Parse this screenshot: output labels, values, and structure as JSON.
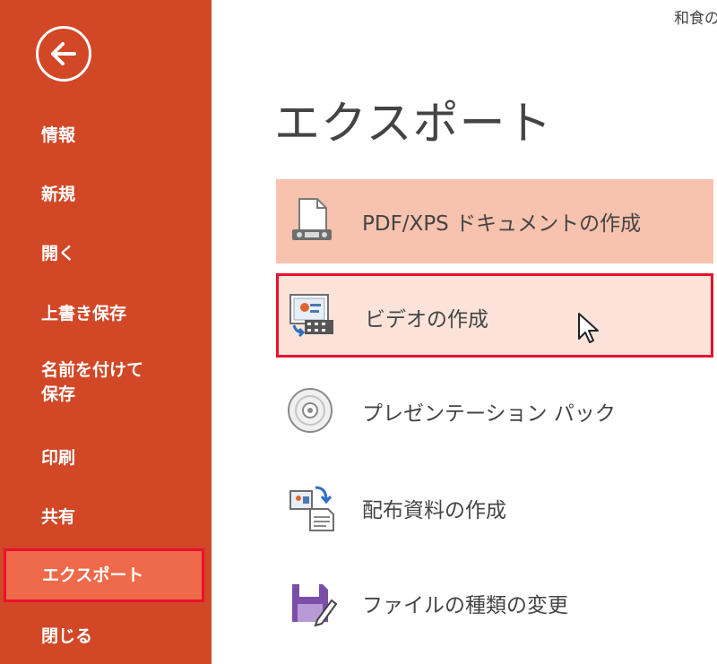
{
  "window": {
    "doc_title": "和食の"
  },
  "sidebar": {
    "back_icon": "back-arrow-icon",
    "items": [
      {
        "label": "情報"
      },
      {
        "label": "新規"
      },
      {
        "label": "開く"
      },
      {
        "label": "上書き保存"
      },
      {
        "label": "名前を付けて",
        "label2": "保存"
      },
      {
        "label": "印刷"
      },
      {
        "label": "共有"
      },
      {
        "label": "エクスポート",
        "selected": true
      },
      {
        "label": "閉じる"
      }
    ]
  },
  "main": {
    "title": "エクスポート",
    "options": [
      {
        "label": "PDF/XPS ドキュメントの作成",
        "icon": "pdf-document-icon",
        "state": "hover"
      },
      {
        "label": "ビデオの作成",
        "icon": "video-icon",
        "state": "selected"
      },
      {
        "label": "プレゼンテーション パック",
        "icon": "cd-icon"
      },
      {
        "label": "配布資料の作成",
        "icon": "handout-icon"
      },
      {
        "label": "ファイルの種類の変更",
        "icon": "save-as-icon"
      }
    ]
  },
  "colors": {
    "sidebar_bg": "#d24726",
    "selected_nav_bg": "#ee6a4a",
    "highlight_border": "#e8112d",
    "hover_option_bg": "#f7c2ae",
    "selected_option_bg": "#fbe3da",
    "text": "#444444"
  }
}
